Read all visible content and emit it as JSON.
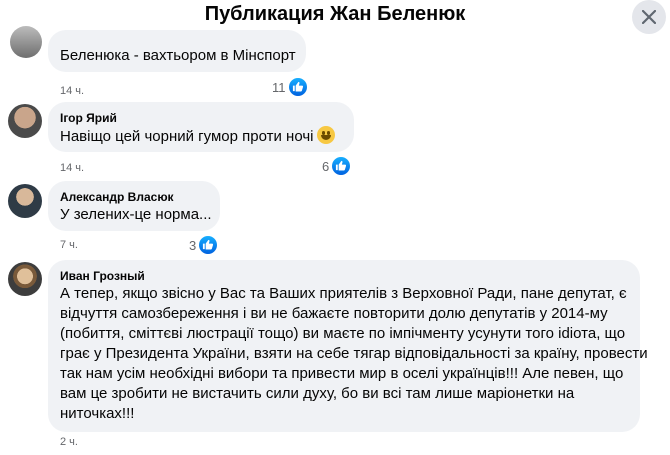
{
  "header": {
    "title": "Публикация Жан Беленюк"
  },
  "comments": [
    {
      "author": "",
      "text": "Беленюка - вахтьором в Мінспорт",
      "time": "14 ч.",
      "likes": "11"
    },
    {
      "author": "Ігор Ярий",
      "text": "Навіщо цей чорний гумор проти ночі",
      "time": "14 ч.",
      "likes": "6"
    },
    {
      "author": "Александр Власюк",
      "text": "У зелених-це норма...",
      "time": "7 ч.",
      "likes": "3"
    },
    {
      "author": "Иван Грозный",
      "lines": [
        "А тепер, якщо звісно у Вас та Ваших приятелів з Верховної Ради, пане депутат, є",
        "відчуття самозбереження і ви не бажаєте повторити долю депутатів у 2014-му",
        "(побиття, сміттєві люстрації тощо) ви маєте по імпічменту усунути того idiота, що",
        "грає у Президента України, взяти на себе тягар відповідальності за країну, провести",
        "так нам усім необхідні вибори та привести мир в оселі українців!!! Але певен, що",
        "вам це зробити не вистачить сили духу, бо ви всі там лише маріонетки на",
        "ниточках!!!"
      ],
      "time": "2 ч."
    }
  ],
  "icons": {
    "close": "close-icon",
    "like": "like-icon",
    "emoji": "smile-emoji-icon"
  },
  "colors": {
    "like_blue": "#1877f2",
    "bubble": "#f0f2f5",
    "meta": "#65676b"
  }
}
